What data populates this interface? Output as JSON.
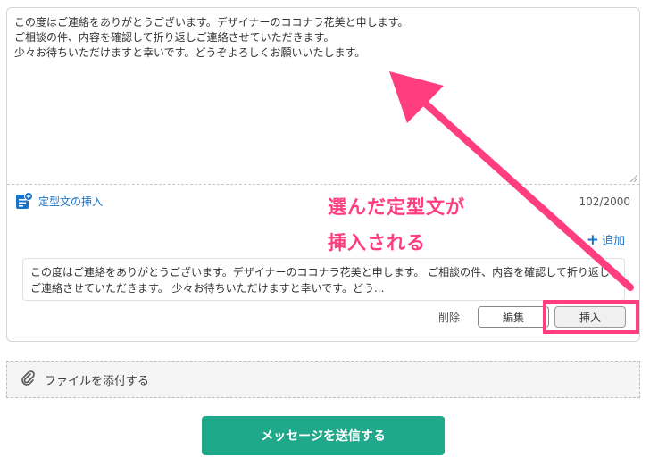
{
  "message": {
    "lines": [
      "この度はご連絡をありがとうございます。デザイナーのココナラ花美と申します。",
      "ご相談の件、内容を確認して折り返しご連絡させていただきます。",
      "少々お待ちいただけますと幸いです。どうぞよろしくお願いいたします。"
    ]
  },
  "template": {
    "link_label": "定型文の挿入",
    "icon": "document-plus-icon"
  },
  "counter": "102/2000",
  "add": {
    "label": "追加",
    "icon": "plus-icon"
  },
  "template_item": {
    "text": "この度はご連絡をありがとうございます。デザイナーのココナラ花美と申します。 ご相談の件、内容を確認して折り返しご連絡させていただきます。 少々お待ちいただけますと幸いです。どう..."
  },
  "actions": {
    "delete": "削除",
    "edit": "編集",
    "insert": "挿入"
  },
  "annotation": {
    "line1": "選んだ定型文が",
    "line2": "挿入される"
  },
  "attachment": {
    "label": "ファイルを添付する",
    "icon": "paperclip-icon"
  },
  "send": {
    "label": "メッセージを送信する"
  },
  "colors": {
    "accent_link": "#1a73c8",
    "send_button": "#1fa98a",
    "annotation": "#ff3d7f"
  }
}
